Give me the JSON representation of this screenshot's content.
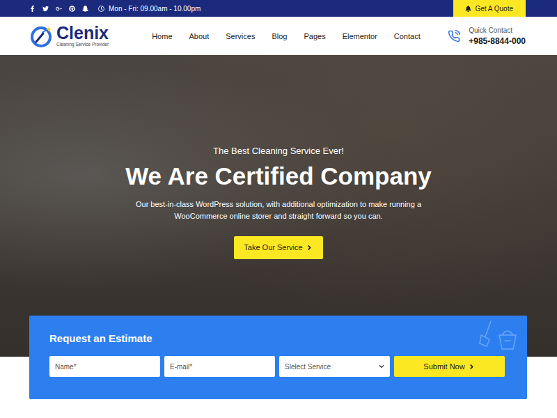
{
  "top_bar": {
    "hours": "Mon - Fri: 09.00am - 10.00pm",
    "quote_button": "Get A Quote"
  },
  "logo": {
    "name": "Clenix",
    "tagline": "Cleaning Service Provider"
  },
  "nav": [
    {
      "label": "Home"
    },
    {
      "label": "About"
    },
    {
      "label": "Services"
    },
    {
      "label": "Blog"
    },
    {
      "label": "Pages"
    },
    {
      "label": "Elementor"
    },
    {
      "label": "Contact"
    }
  ],
  "contact": {
    "label": "Quick Contact",
    "phone": "+985-8844-000"
  },
  "hero": {
    "subtitle": "The Best Cleaning Service Ever!",
    "title": "We Are Certified Company",
    "description": "Our best-in-class WordPress solution, with additional optimization to make running a WooCommerce online storer and straight forward so you can.",
    "button": "Take Our Service"
  },
  "estimate": {
    "title": "Request an Estimate",
    "fields": [
      {
        "placeholder": "Name*",
        "kind": "input"
      },
      {
        "placeholder": "E-mail*",
        "kind": "input"
      },
      {
        "placeholder": "Slelect Service",
        "kind": "select"
      }
    ],
    "button": "Submit Now"
  }
}
